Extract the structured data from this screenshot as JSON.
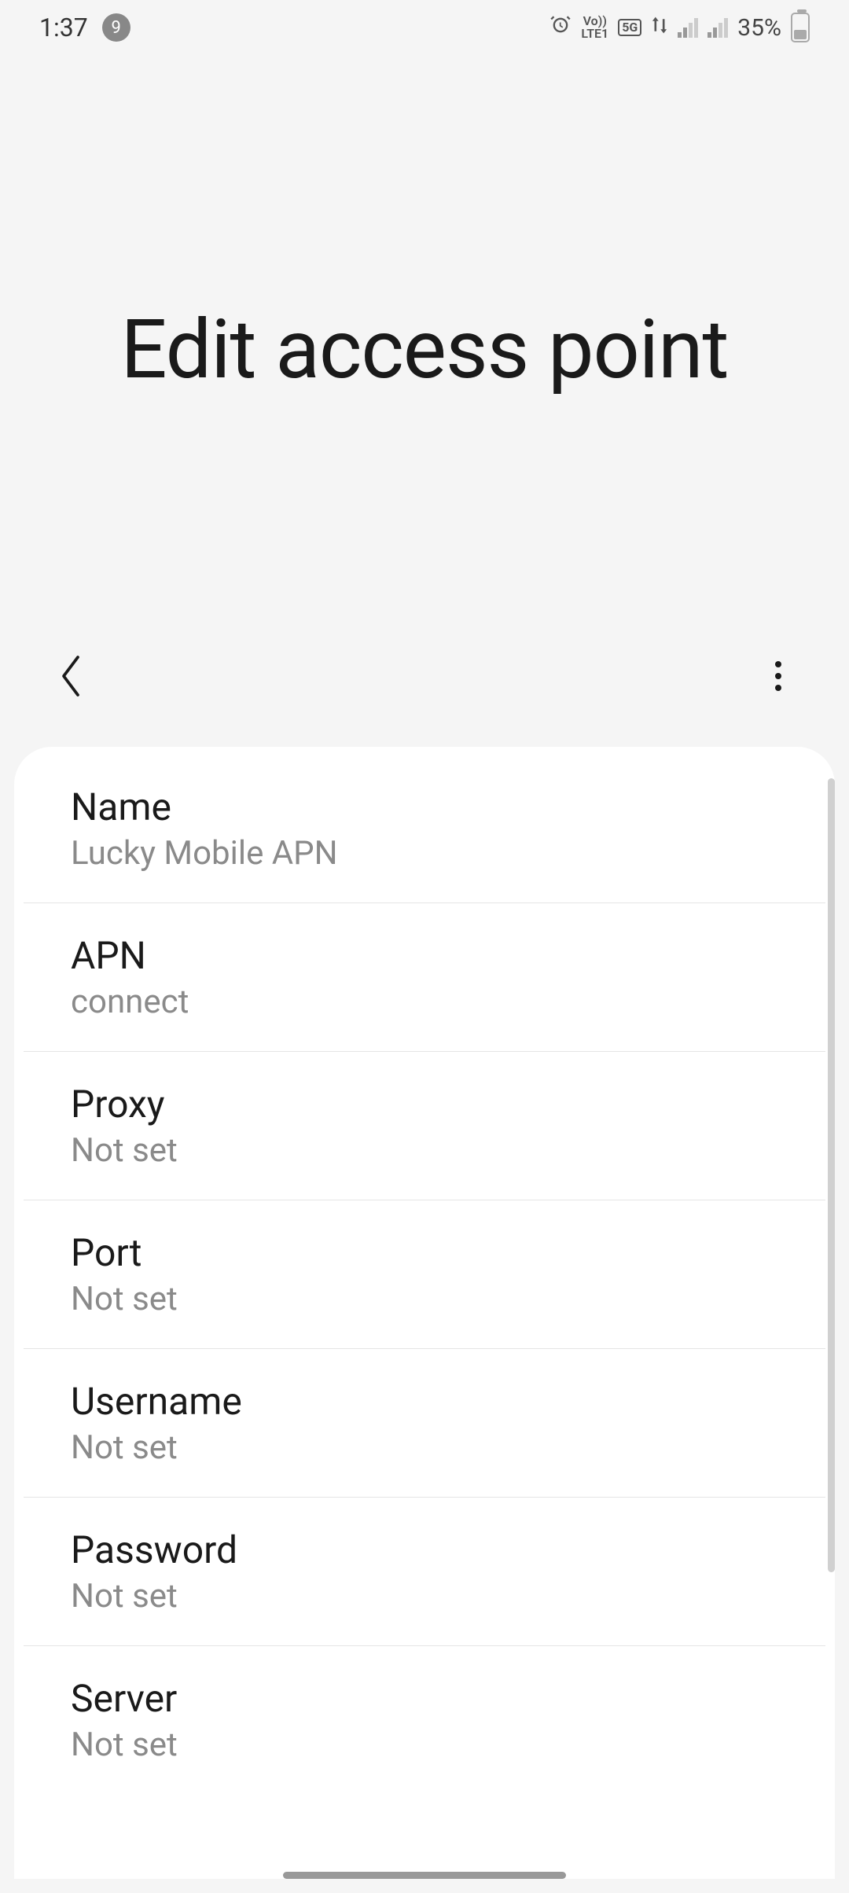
{
  "statusbar": {
    "time": "1:37",
    "notification_count": "9",
    "volte_label": "Vo))",
    "lte_label": "LTE1",
    "fiveg_label": "5G",
    "battery_percent": "35%"
  },
  "header": {
    "title": "Edit access point"
  },
  "settings": [
    {
      "label": "Name",
      "value": "Lucky Mobile APN"
    },
    {
      "label": "APN",
      "value": "connect"
    },
    {
      "label": "Proxy",
      "value": "Not set"
    },
    {
      "label": "Port",
      "value": "Not set"
    },
    {
      "label": "Username",
      "value": "Not set"
    },
    {
      "label": "Password",
      "value": "Not set"
    },
    {
      "label": "Server",
      "value": "Not set"
    }
  ]
}
